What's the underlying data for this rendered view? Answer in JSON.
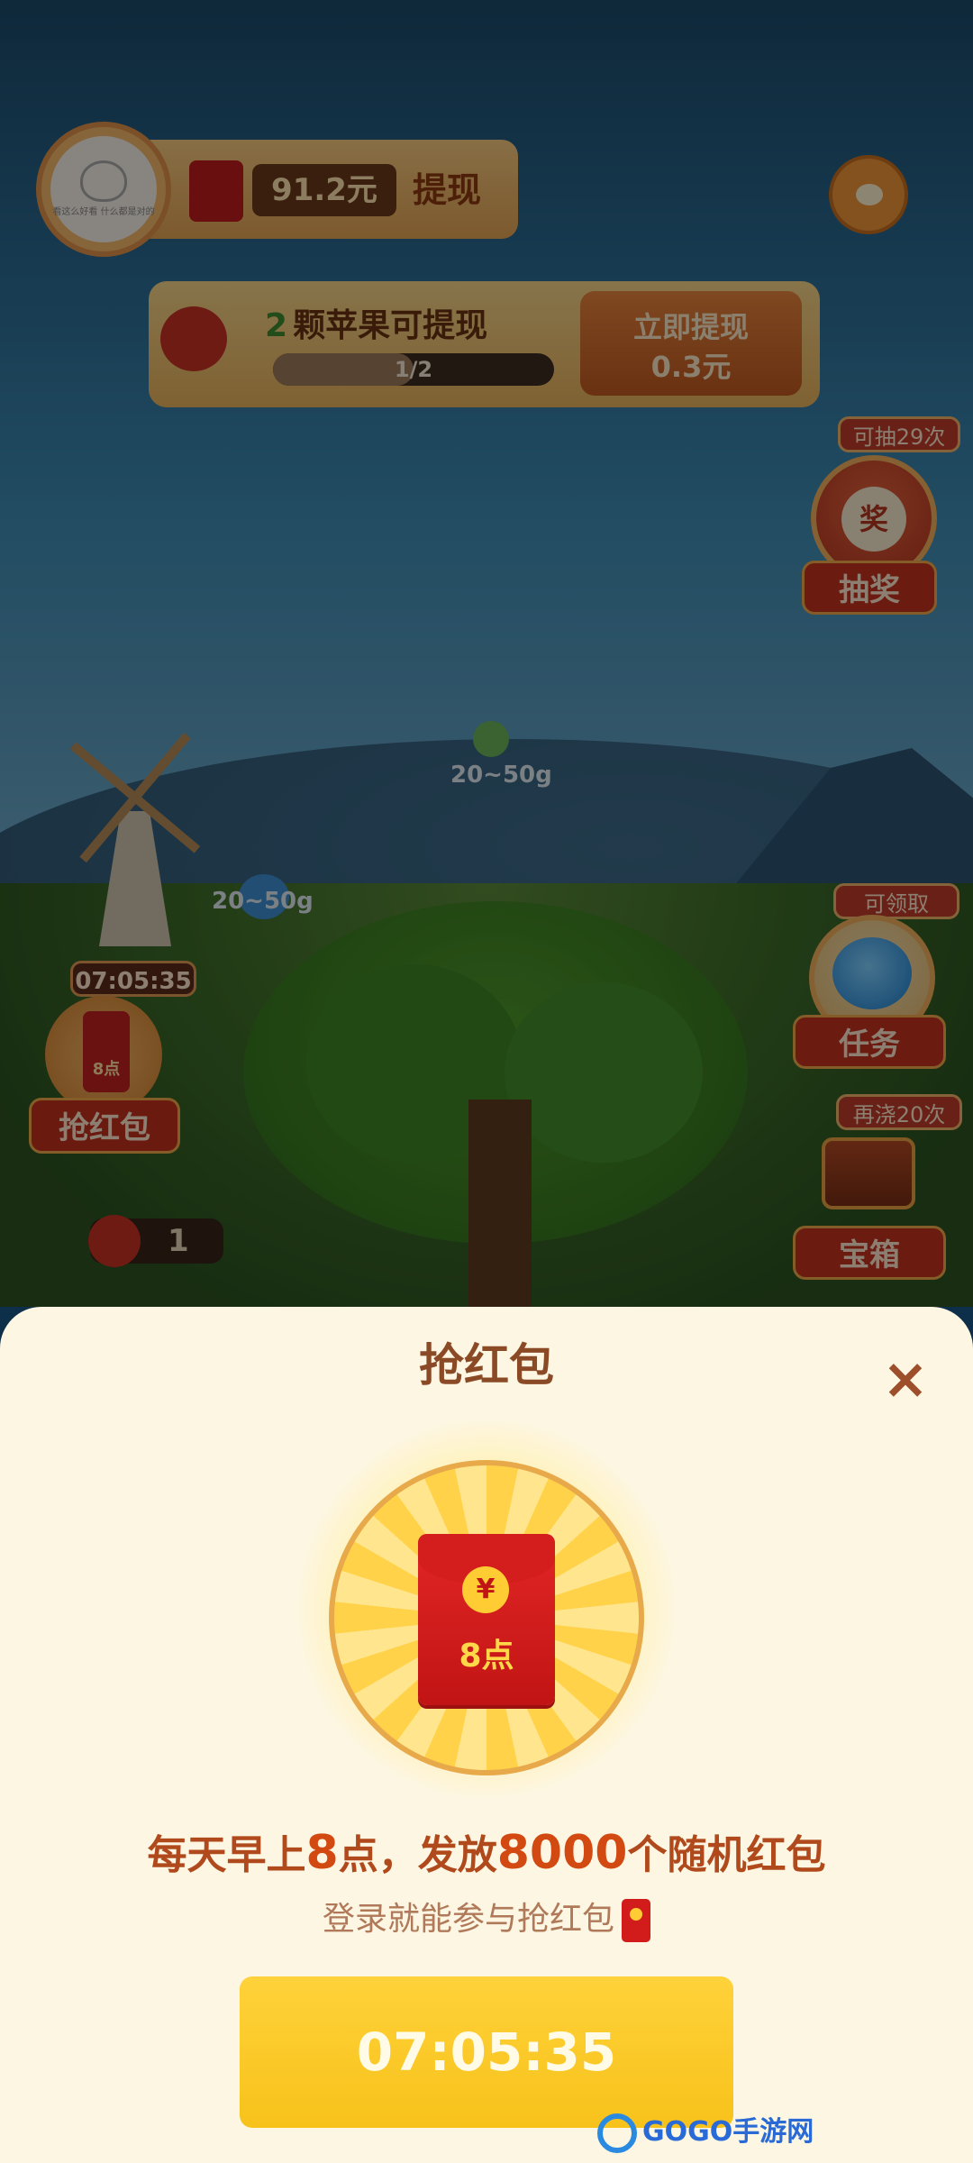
{
  "header": {
    "avatar_text": "看这么好看\n什么都是对的",
    "balance": "91.2元",
    "withdraw_label": "提现"
  },
  "apple_card": {
    "count": "2",
    "title": "颗苹果可提现",
    "progress_text": "1/2",
    "progress_fraction": 0.5,
    "instant_label": "立即提现",
    "instant_amount": "0.3元"
  },
  "side_right": {
    "lottery_badge": "可抽29次",
    "lottery_icon_text": "奖",
    "lottery_label": "抽奖",
    "task_badge": "可领取",
    "task_label": "任务",
    "chest_badge": "再浇20次",
    "chest_label": "宝箱"
  },
  "side_left": {
    "timer": "07:05:35",
    "redpack_time": "8点",
    "grab_label": "抢红包",
    "apple_count": "1"
  },
  "scene": {
    "drop_blue_label": "20~50g",
    "drop_green_label": "20~50g"
  },
  "sheet": {
    "title": "抢红包",
    "close_icon": "×",
    "yen_symbol": "¥",
    "envelope_label": "8点",
    "headline_part1": "每天早上",
    "headline_num1": "8",
    "headline_part2": "点，发放",
    "headline_num2": "8000",
    "headline_part3": "个随机红包",
    "subline": "登录就能参与抢红包",
    "countdown": "07:05:35"
  },
  "watermark": {
    "text": "GOGO手游网"
  },
  "colors": {
    "accent_red": "#c11414",
    "accent_yellow": "#ffd23a",
    "sheet_bg": "#fdf6e3",
    "title_brown": "#8b4a26"
  }
}
